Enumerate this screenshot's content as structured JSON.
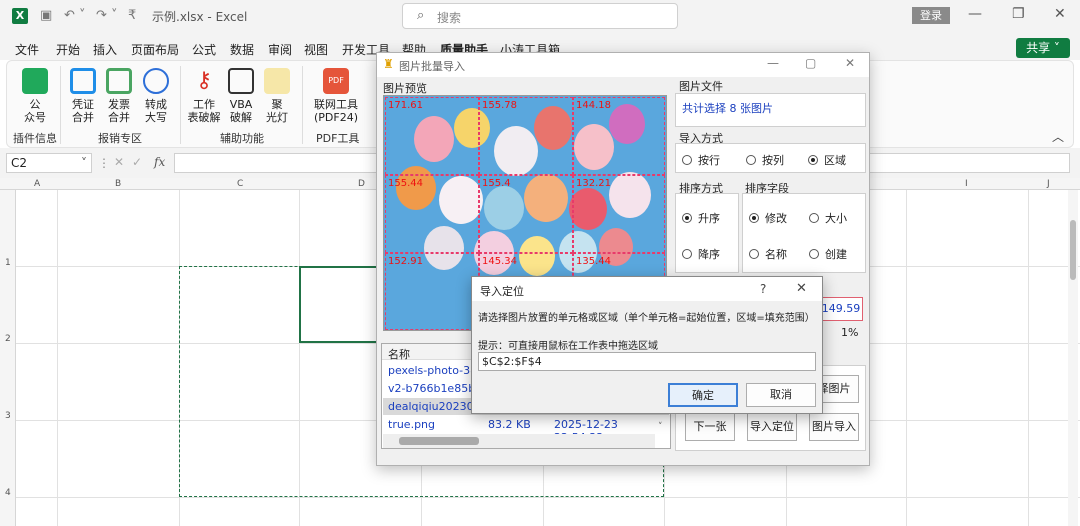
{
  "window": {
    "logo": "X",
    "title": "示例.xlsx  -  Excel",
    "search_placeholder": "搜索",
    "login": "登录"
  },
  "tabs": [
    "文件",
    "开始",
    "插入",
    "页面布局",
    "公式",
    "数据",
    "审阅",
    "视图",
    "开发工具",
    "帮助",
    "质量助手",
    "小涛工具箱"
  ],
  "share": "共享",
  "ribbon": {
    "items": [
      {
        "label1": "公",
        "label2": "众号",
        "color": "#20a95b"
      },
      {
        "label1": "凭证",
        "label2": "合并",
        "color": "#1f8ee8"
      },
      {
        "label1": "发票",
        "label2": "合并",
        "color": "#4aa562"
      },
      {
        "label1": "转成",
        "label2": "大写",
        "color": "#2d6fd8"
      },
      {
        "label1": "工作",
        "label2": "表破解",
        "color": "#d93025"
      },
      {
        "label1": "VBA",
        "label2": "破解",
        "color": "#333333"
      },
      {
        "label1": "聚",
        "label2": "光灯",
        "color": "#e8c23a"
      },
      {
        "label1": "联网工具",
        "label2": "(PDF24)",
        "color": "#e5553a"
      }
    ],
    "groups": [
      "插件信息",
      "报销专区",
      "辅助功能",
      "PDF工具"
    ]
  },
  "formula": {
    "namebox": "C2",
    "fx": "fx"
  },
  "columns": [
    "A",
    "B",
    "C",
    "D",
    "E",
    "F",
    "G",
    "H",
    "I",
    "J"
  ],
  "rows": [
    "1",
    "2",
    "3",
    "4"
  ],
  "dialog1": {
    "title": "图片批量导入",
    "preview_label": "图片预览",
    "grid_values": [
      "171.61",
      "155.78",
      "144.18",
      "155.44",
      "155.4",
      "132.21",
      "152.91",
      "145.34",
      "135.44"
    ],
    "file_label": "图片文件",
    "file_summary": "共计选择 8 张图片",
    "import_mode_label": "导入方式",
    "import_modes": [
      "按行",
      "按列",
      "区域"
    ],
    "import_mode_selected": "区域",
    "sort_label": "排序方式",
    "sort_field_label": "排序字段",
    "sort_orders": [
      "升序",
      "降序"
    ],
    "sort_fields": [
      "修改",
      "大小",
      "名称",
      "创建"
    ],
    "height_value": ":149.59",
    "percent": "1%",
    "list_header": [
      "名称"
    ],
    "files": [
      {
        "name": "pexels-photo-38..",
        "size": "",
        "date": ""
      },
      {
        "name": "v2-b766b1e85ba..",
        "size": "",
        "date": ""
      },
      {
        "name": "dealqiqiu202306..",
        "size": "",
        "date": ""
      },
      {
        "name": "true.png",
        "size": "83.2 KB",
        "date": "2025-12-23 22:54:22"
      }
    ],
    "btn_select": "择图片",
    "btn_next": "下一张",
    "btn_locate": "导入定位",
    "btn_import": "图片导入"
  },
  "dialog2": {
    "title": "导入定位",
    "help": "?",
    "desc": "请选择图片放置的单元格或区域（单个单元格=起始位置，区域=填充范围）",
    "hint": "提示：可直接用鼠标在工作表中拖选区域",
    "value": "$C$2:$F$4",
    "ok": "确定",
    "cancel": "取消"
  }
}
